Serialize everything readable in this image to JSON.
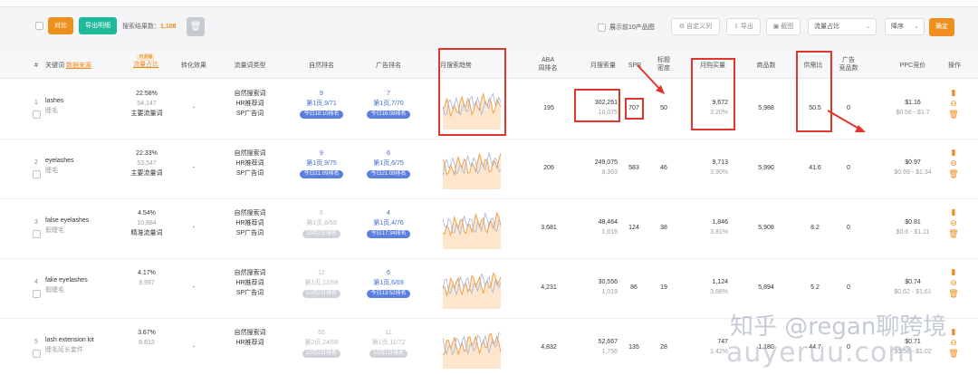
{
  "toolbar": {
    "compare_label": "对比",
    "export_detail_label": "导出明细",
    "result_label": "搜索结果数：",
    "result_count": "1,108",
    "top10_label": "展示前10产品图",
    "custom_col_label": "自定义列",
    "export_label": "导出",
    "screenshot_label": "截图",
    "sort_select": "流量占比",
    "order_select": "降序",
    "confirm_label": "确定"
  },
  "header": {
    "index": "#",
    "keyword": "关键词",
    "data_source": "数据来源",
    "traffic_share_badge": "内测版",
    "traffic_share": "流量占比",
    "conversion": "转化效果",
    "traffic_type": "流量词类型",
    "organic_rank": "自然排名",
    "ad_rank": "广告排名",
    "monthly_trend": "月搜索趋势",
    "aba_rank_1": "ABA",
    "aba_rank_2": "周排名",
    "monthly_search": "月搜索量",
    "spr": "SPR",
    "title_density_1": "标题",
    "title_density_2": "密度",
    "monthly_purchase": "月购买量",
    "product_count": "商品数",
    "supply_demand": "供需比",
    "ad_products_1": "广告",
    "ad_products_2": "竞品数",
    "ppc": "PPC竞价",
    "action": "操作"
  },
  "rows": [
    {
      "index": "1",
      "keyword": "lashes",
      "translation": "睫毛",
      "share": "22.58%",
      "share_num": "54,147",
      "share_tag": "主要流量词",
      "conversion": "-",
      "type1": "自然搜索词",
      "type2": "HR推荐词",
      "type3": "SP广告词",
      "organic_pos": "9",
      "organic_page": "第1页,9/71",
      "organic_pill": "今日18:10排名",
      "ad_pos": "7",
      "ad_page": "第1页,7/70",
      "ad_pill": "今日16:08排名",
      "aba": "195",
      "search": "302,261",
      "search_sub": "10,075",
      "spr": "707",
      "density": "50",
      "purchase": "9,672",
      "purchase_rate": "3.20%",
      "products": "5,988",
      "ratio": "50.5",
      "ad_products": "0",
      "ppc": "$1.16",
      "ppc_range": "$0.56 - $1.7"
    },
    {
      "index": "2",
      "keyword": "eyelashes",
      "translation": "睫毛",
      "share": "22.33%",
      "share_num": "53,547",
      "share_tag": "主要流量词",
      "conversion": "-",
      "type1": "自然搜索词",
      "type2": "HR推荐词",
      "type3": "SP广告词",
      "organic_pos": "9",
      "organic_page": "第1页,9/75",
      "organic_pill": "今日21:09排名",
      "ad_pos": "6",
      "ad_page": "第1页,6/75",
      "ad_pill": "今日21:09排名",
      "aba": "206",
      "search": "249,075",
      "search_sub": "8,303",
      "spr": "583",
      "density": "46",
      "purchase": "9,713",
      "purchase_rate": "3.90%",
      "products": "5,990",
      "ratio": "41.6",
      "ad_products": "0",
      "ppc": "$0.97",
      "ppc_range": "$0.69 - $1.34"
    },
    {
      "index": "3",
      "keyword": "false eyelashes",
      "translation": "假睫毛",
      "share": "4.54%",
      "share_num": "10,884",
      "share_tag": "精准流量词",
      "conversion": "-",
      "type1": "自然搜索词",
      "type2": "HR推荐词",
      "type3": "SP广告词",
      "organic_pos": "6",
      "organic_page": "第1页,6/69",
      "organic_pill": "10月2日排名",
      "ad_pos": "4",
      "ad_page": "第1页,4/76",
      "ad_pill": "今日17:34排名",
      "aba": "3,681",
      "search": "48,464",
      "search_sub": "1,615",
      "spr": "124",
      "density": "38",
      "purchase": "1,846",
      "purchase_rate": "3.81%",
      "products": "5,908",
      "ratio": "8.2",
      "ad_products": "0",
      "ppc": "$0.81",
      "ppc_range": "$0.6 - $1.11"
    },
    {
      "index": "4",
      "keyword": "fake eyelashes",
      "translation": "假睫毛",
      "share": "4.17%",
      "share_num": "9,997",
      "share_tag": "",
      "conversion": "-",
      "type1": "自然搜索词",
      "type2": "HR推荐词",
      "type3": "SP广告词",
      "organic_pos": "12",
      "organic_page": "第1页,12/69",
      "organic_pill": "10月2日排名",
      "ad_pos": "6",
      "ad_page": "第1页,6/69",
      "ad_pill": "今日13:52排名",
      "aba": "4,231",
      "search": "30,556",
      "search_sub": "1,019",
      "spr": "86",
      "density": "19",
      "purchase": "1,124",
      "purchase_rate": "3.68%",
      "products": "5,894",
      "ratio": "5.2",
      "ad_products": "0",
      "ppc": "$0.74",
      "ppc_range": "$0.62 - $1.61"
    },
    {
      "index": "5",
      "keyword": "lash extension kit",
      "translation": "睫毛延长套件",
      "share": "3.67%",
      "share_num": "8,813",
      "share_tag": "",
      "conversion": "-",
      "type1": "自然搜索词",
      "type2": "HR推荐词",
      "type3": "",
      "organic_pos": "65",
      "organic_page": "第2页,24/68",
      "organic_pill": "10月2日排名",
      "ad_pos": "11",
      "ad_page": "第1页,11/72",
      "ad_pill": "10月1日排名",
      "aba": "4,832",
      "search": "52,667",
      "search_sub": "1,756",
      "spr": "135",
      "density": "28",
      "purchase": "747",
      "purchase_rate": "1.42%",
      "products": "1,180",
      "ratio": "44.7",
      "ad_products": "0",
      "ppc": "$0.71",
      "ppc_range": "$0.58 - $1.02"
    }
  ],
  "watermark": {
    "line1": "知乎 @regan聊跨境",
    "line2": "auyeruu.com"
  },
  "colors": {
    "accent_orange": "#f0901c",
    "accent_teal": "#1db99a",
    "highlight_red": "#e0352b",
    "link_blue": "#3d6bd6"
  }
}
